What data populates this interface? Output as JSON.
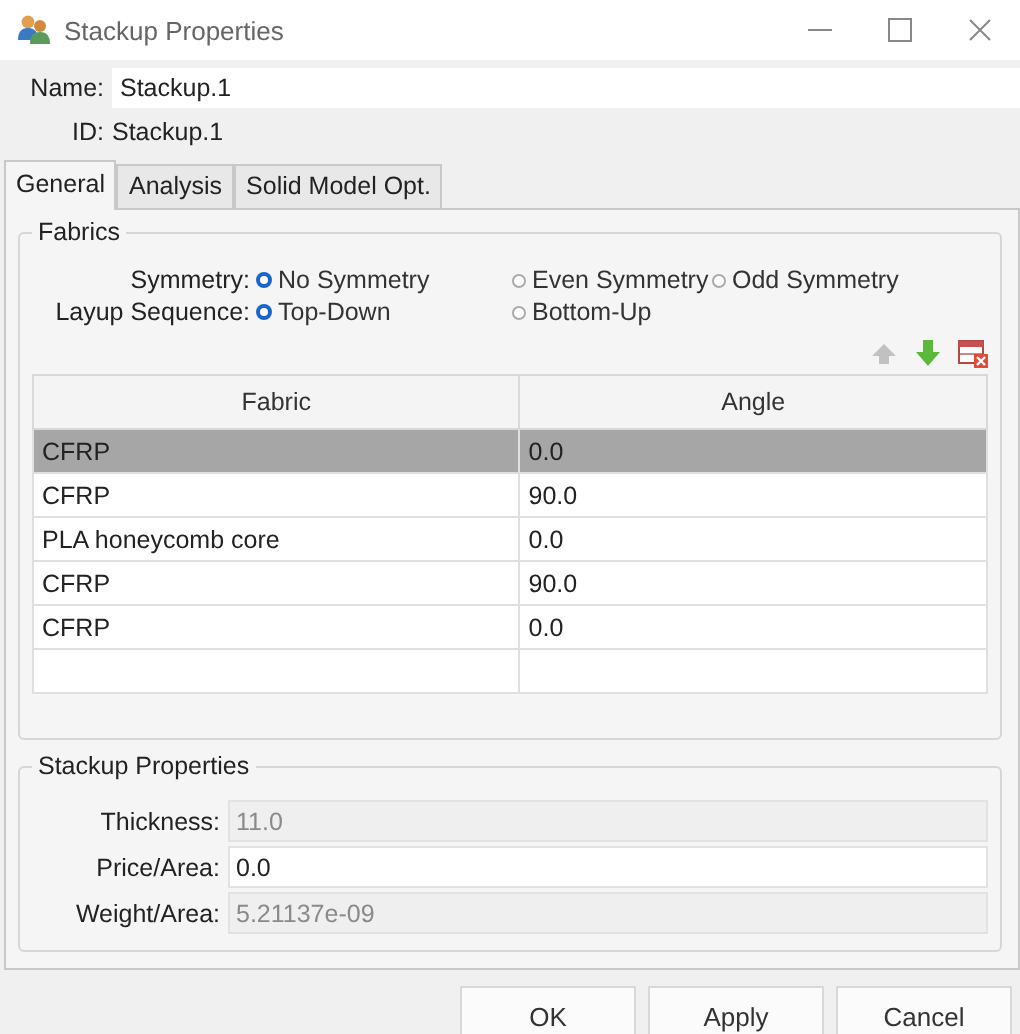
{
  "window": {
    "title": "Stackup Properties"
  },
  "name": {
    "label": "Name:",
    "value": "Stackup.1"
  },
  "id": {
    "label": "ID:",
    "value": "Stackup.1"
  },
  "tabs": [
    {
      "label": "General",
      "selected": true
    },
    {
      "label": "Analysis",
      "selected": false
    },
    {
      "label": "Solid Model Opt.",
      "selected": false
    }
  ],
  "fabrics": {
    "title": "Fabrics",
    "radio_groups": [
      {
        "label": "Symmetry:",
        "options": [
          {
            "label": "No Symmetry",
            "selected": true
          },
          {
            "label": "Even Symmetry",
            "selected": false
          },
          {
            "label": "Odd Symmetry",
            "selected": false
          }
        ]
      },
      {
        "label": "Layup Sequence:",
        "options": [
          {
            "label": "Top-Down",
            "selected": true
          },
          {
            "label": "Bottom-Up",
            "selected": false
          }
        ]
      }
    ],
    "toolbar": [
      {
        "kind": "up",
        "disabled": true
      },
      {
        "kind": "down",
        "disabled": false
      },
      {
        "kind": "delete",
        "disabled": false
      }
    ],
    "table": {
      "columns": [
        "Fabric",
        "Angle"
      ],
      "rows": [
        {
          "cells": [
            "CFRP",
            "0.0"
          ],
          "selected": true
        },
        {
          "cells": [
            "CFRP",
            "90.0"
          ],
          "selected": false
        },
        {
          "cells": [
            "PLA honeycomb core",
            "0.0"
          ],
          "selected": false
        },
        {
          "cells": [
            "CFRP",
            "90.0"
          ],
          "selected": false
        },
        {
          "cells": [
            "CFRP",
            "0.0"
          ],
          "selected": false
        }
      ]
    }
  },
  "stackup_properties": {
    "title": "Stackup Properties",
    "fields": [
      {
        "label": "Thickness:",
        "value": "11.0",
        "disabled": true
      },
      {
        "label": "Price/Area:",
        "value": "0.0",
        "disabled": false
      },
      {
        "label": "Weight/Area:",
        "value": "5.21137e-09",
        "disabled": true
      }
    ]
  },
  "buttons": [
    "OK",
    "Apply",
    "Cancel"
  ]
}
